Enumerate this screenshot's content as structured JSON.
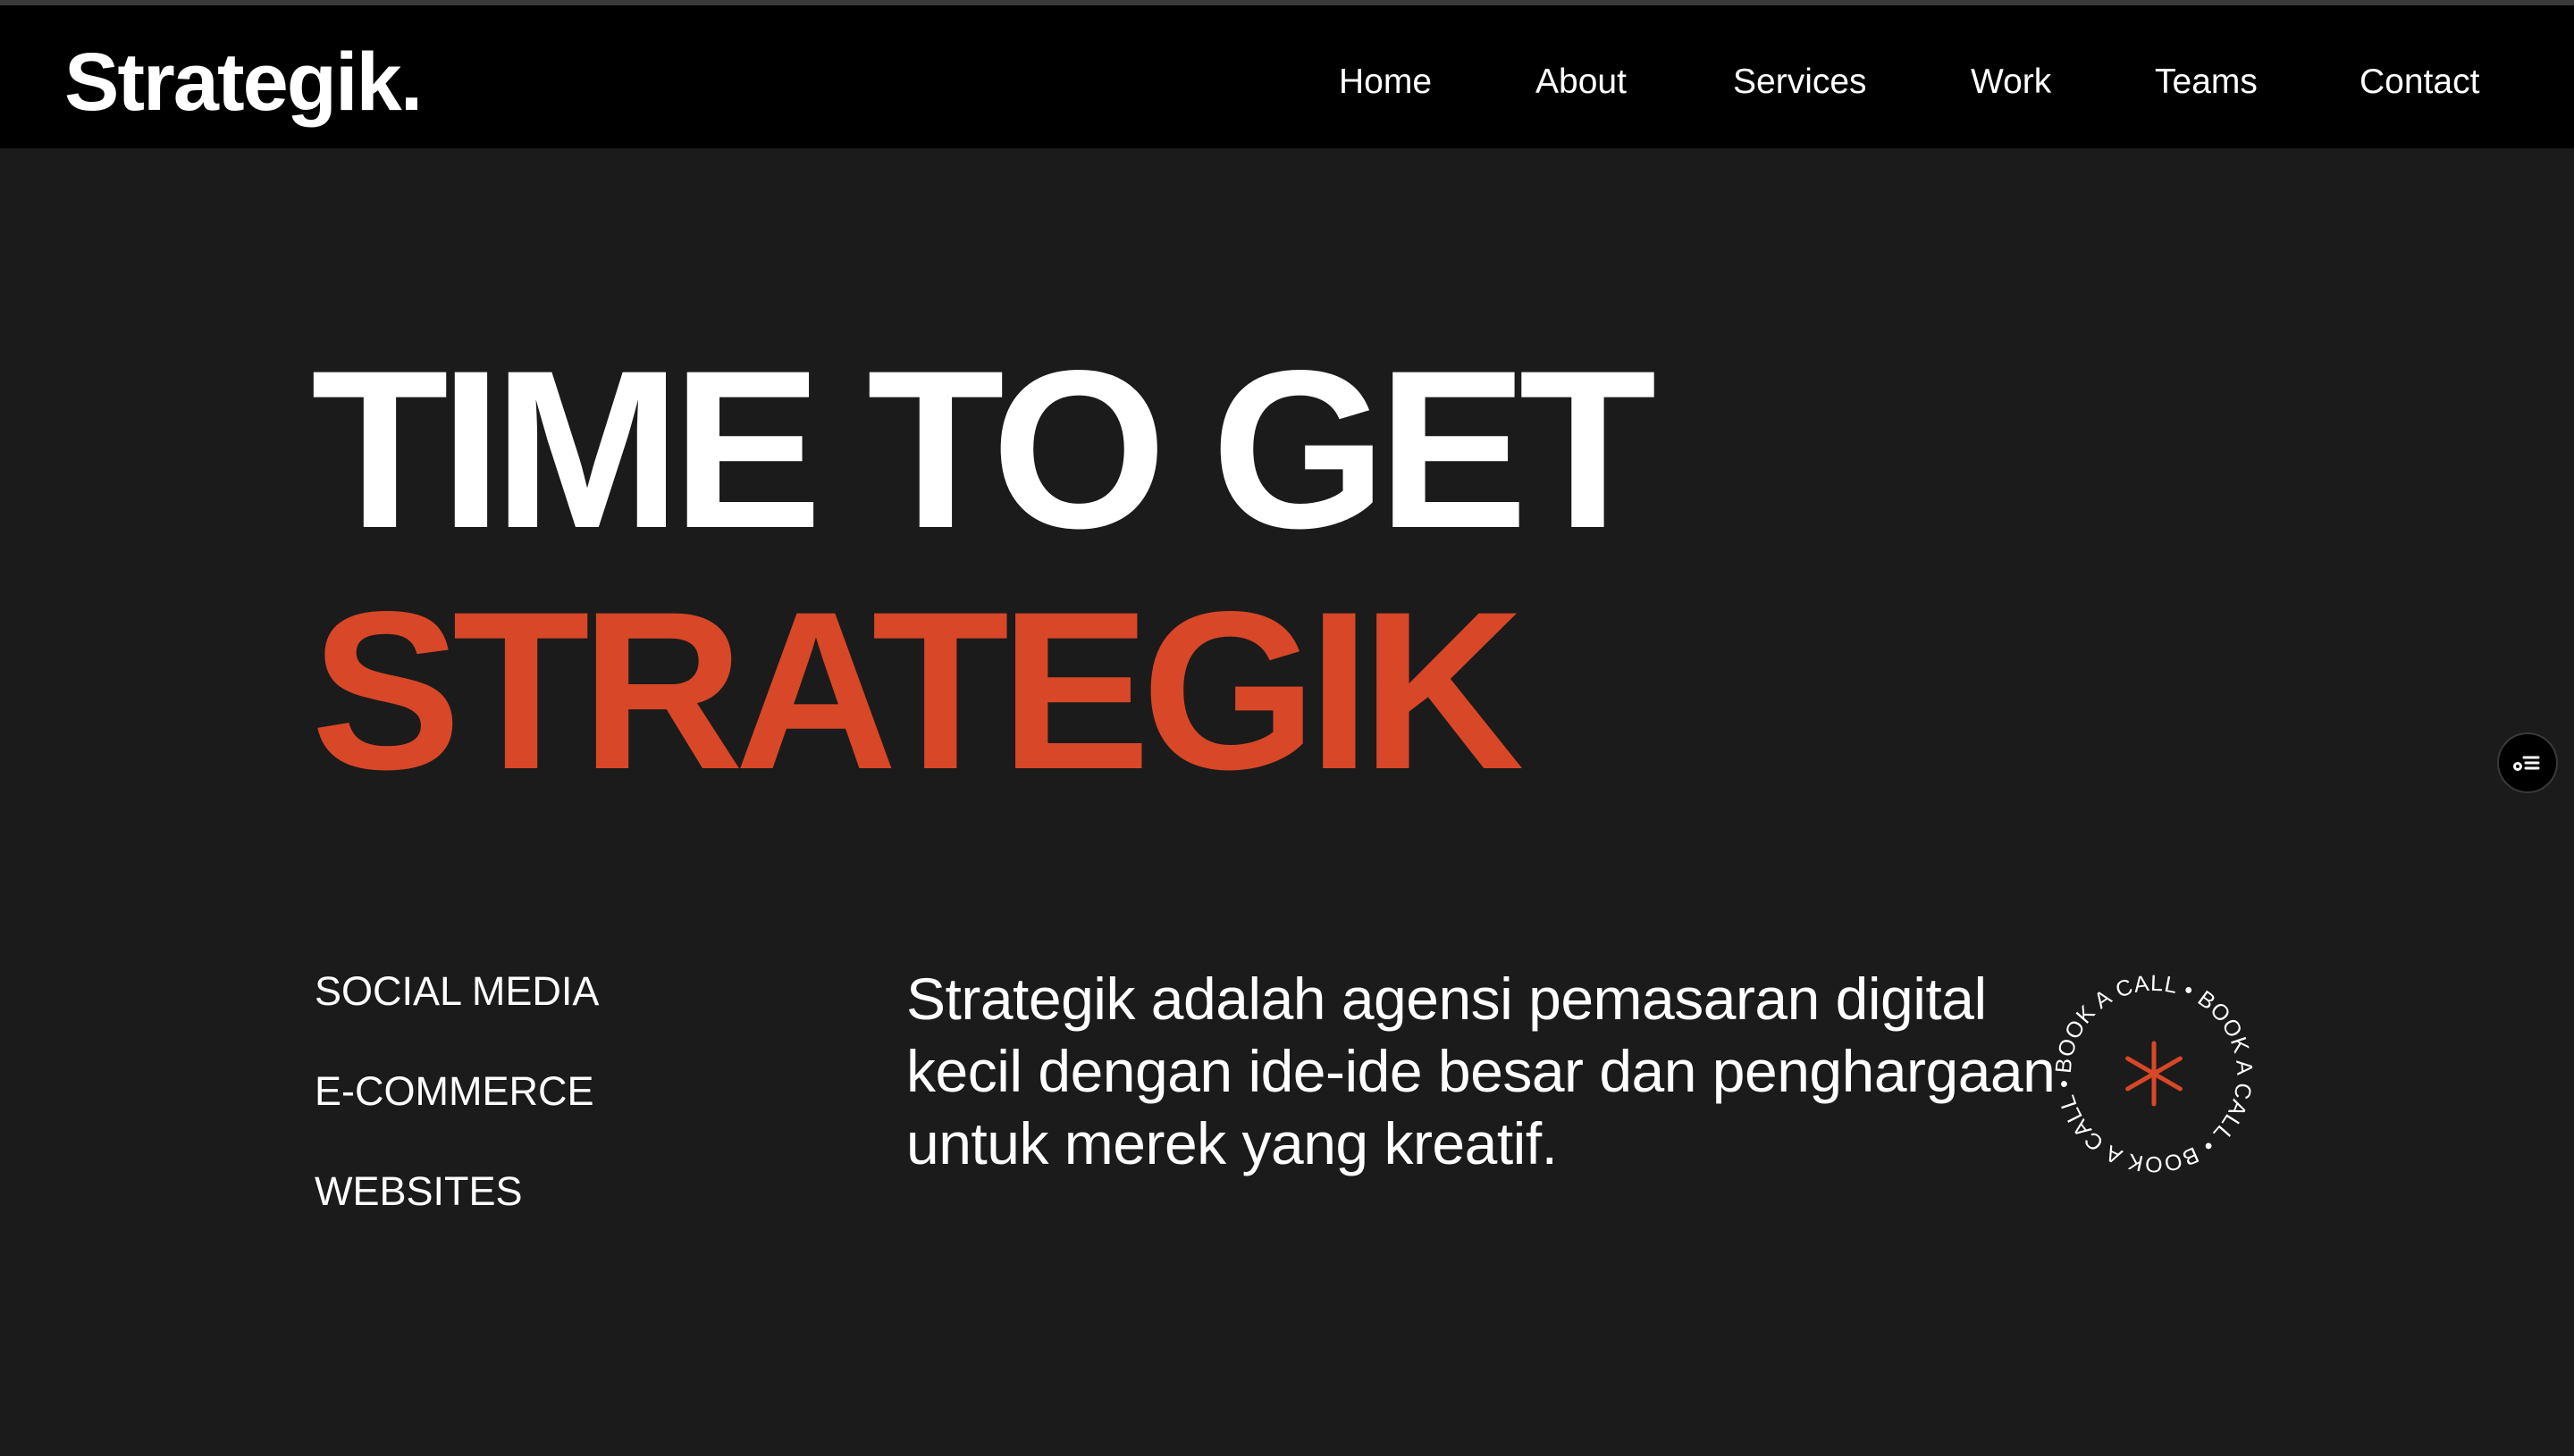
{
  "brand": {
    "logo": "Strategik."
  },
  "nav": {
    "items": [
      {
        "label": "Home"
      },
      {
        "label": "About"
      },
      {
        "label": "Services"
      },
      {
        "label": "Work"
      },
      {
        "label": "Teams"
      },
      {
        "label": "Contact"
      }
    ]
  },
  "hero": {
    "line1": "TIME TO GET",
    "line2": "STRATEGIK"
  },
  "services": [
    {
      "label": "SOCIAL MEDIA"
    },
    {
      "label": "E-COMMERCE"
    },
    {
      "label": "WEBSITES"
    }
  ],
  "tagline": "Strategik adalah agensi pemasaran digital kecil dengan ide-ide besar dan penghargaan untuk merek yang kreatif.",
  "cta_badge": {
    "ring_text": "BOOK A CALL • BOOK A CALL • BOOK A CALL • ",
    "icon": "asterisk-icon"
  },
  "side_widget": {
    "icon": "settings-list-icon"
  },
  "colors": {
    "accent": "#d84727",
    "background": "#1b1b1b",
    "nav_background": "#000000",
    "text": "#ffffff"
  }
}
